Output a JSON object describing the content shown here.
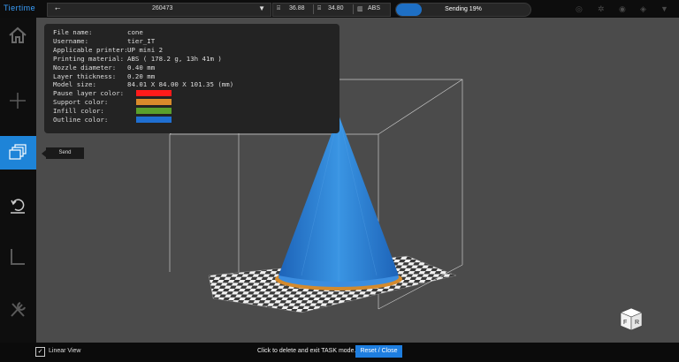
{
  "topbar": {
    "brand": "Tiertime",
    "device": "260473",
    "nozzle_temp": "36.88",
    "bed_temp": "34.80",
    "material": "ABS",
    "progress_label": "Sending 19%",
    "progress_fraction": 0.19
  },
  "tooltip": "Send",
  "info": {
    "rows": [
      {
        "label": "File name:",
        "value": "cone"
      },
      {
        "label": "Username:",
        "value": "tier_IT"
      },
      {
        "label": "Applicable printer:",
        "value": "UP mini 2"
      },
      {
        "label": "Printing material:",
        "value": "ABS ( 178.2 g,  13h 41m )"
      },
      {
        "label": "Nozzle diameter:",
        "value": "0.40     mm"
      },
      {
        "label": "Layer thickness:",
        "value": "0.20     mm"
      },
      {
        "label": "Model size:",
        "value": "84.01    X 84.00    X 101.35    (mm)"
      },
      {
        "label": "Pause layer color:",
        "value": ""
      },
      {
        "label": "Support color:",
        "value": ""
      },
      {
        "label": "Infill color:",
        "value": ""
      },
      {
        "label": "Outline color:",
        "value": ""
      }
    ],
    "colors": {
      "pause_layer": "#ff1a1a",
      "support": "#d98a2b",
      "infill": "#5aa02c",
      "outline": "#1f6fd1"
    }
  },
  "bottom": {
    "linear_view_label": "Linear View",
    "linear_view_checked": true,
    "hint": "Click to delete and exit TASK mode.",
    "reset_label": "Reset / Close"
  },
  "cube": {
    "front": "F",
    "right": "R"
  },
  "colors": {
    "accent": "#1e84d8",
    "model": "#2f86d8"
  }
}
